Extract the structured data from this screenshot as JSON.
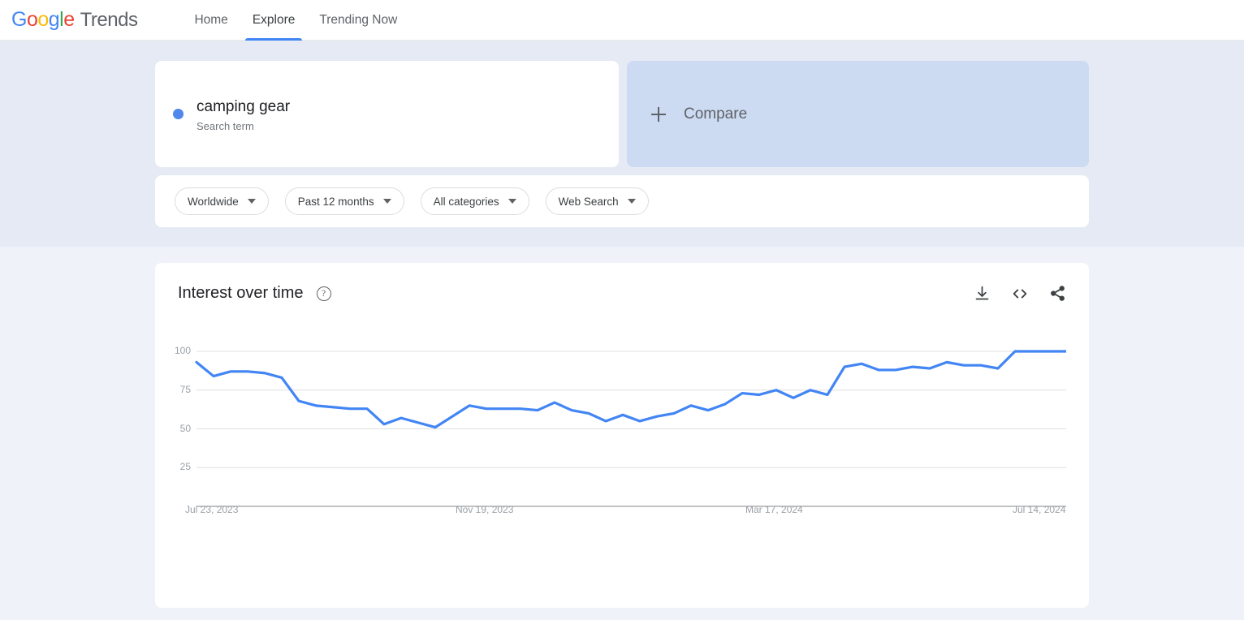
{
  "header": {
    "logo_word": "Google",
    "logo_product": "Trends",
    "nav": [
      {
        "label": "Home",
        "active": false
      },
      {
        "label": "Explore",
        "active": true
      },
      {
        "label": "Trending Now",
        "active": false
      }
    ]
  },
  "explore": {
    "term": {
      "name": "camping gear",
      "type": "Search term",
      "dot_color": "#5087ed"
    },
    "compare": {
      "label": "Compare",
      "icon": "plus-icon"
    },
    "filters": [
      {
        "label": "Worldwide",
        "name": "location"
      },
      {
        "label": "Past 12 months",
        "name": "time-range"
      },
      {
        "label": "All categories",
        "name": "category"
      },
      {
        "label": "Web Search",
        "name": "search-type"
      }
    ]
  },
  "chart_card": {
    "title": "Interest over time",
    "help_icon": "help-circle-icon",
    "actions": [
      {
        "name": "download-icon",
        "label": "Download"
      },
      {
        "name": "embed-code-icon",
        "label": "Embed"
      },
      {
        "name": "share-icon",
        "label": "Share"
      }
    ]
  },
  "chart_data": {
    "type": "line",
    "title": "Interest over time",
    "xlabel": "",
    "ylabel": "",
    "ylim": [
      0,
      100
    ],
    "yticks": [
      100,
      75,
      50,
      25
    ],
    "grid": true,
    "legend": false,
    "line_color": "#4285F4",
    "x_tick_labels": [
      "Jul 23, 2023",
      "Nov 19, 2023",
      "Mar 17, 2024",
      "Jul 14, 2024"
    ],
    "x_tick_indices": [
      0,
      17,
      34,
      51
    ],
    "series": [
      {
        "name": "camping gear",
        "values": [
          93,
          84,
          87,
          87,
          86,
          83,
          68,
          65,
          64,
          63,
          63,
          53,
          57,
          54,
          51,
          58,
          65,
          63,
          63,
          63,
          62,
          67,
          62,
          60,
          55,
          59,
          55,
          58,
          60,
          65,
          62,
          66,
          73,
          72,
          75,
          70,
          75,
          72,
          90,
          92,
          88,
          88,
          90,
          89,
          93,
          91,
          91,
          89,
          100,
          100,
          100,
          100
        ]
      }
    ]
  }
}
